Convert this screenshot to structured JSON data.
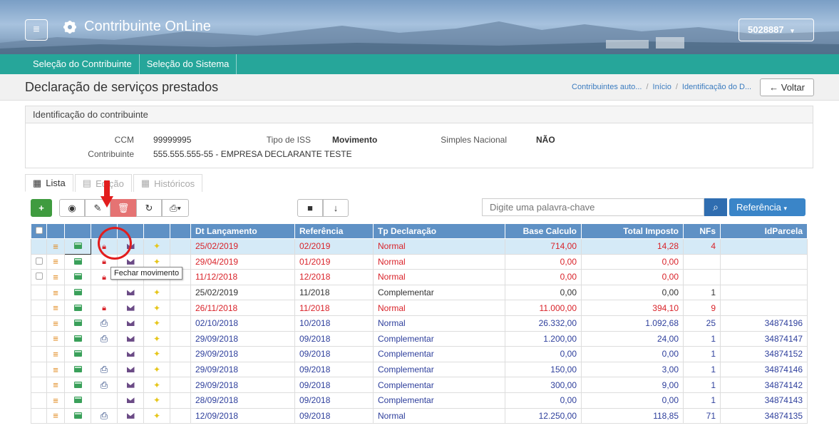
{
  "header": {
    "app_title": "Contribuinte OnLine",
    "user_id": "5028887"
  },
  "nav": {
    "items": [
      "Seleção do Contribuinte",
      "Seleção do Sistema"
    ]
  },
  "page": {
    "title": "Declaração de serviços prestados",
    "breadcrumbs": [
      "Contribuintes auto...",
      "Início",
      "Identificação do D..."
    ],
    "back_label": "Voltar"
  },
  "panel": {
    "title": "Identificação do contribuinte",
    "ccm_label": "CCM",
    "ccm_value": "99999995",
    "contribuinte_label": "Contribuinte",
    "contribuinte_value": "555.555.555-55 - EMPRESA DECLARANTE TESTE",
    "tipo_iss_label": "Tipo de ISS",
    "tipo_iss_value": "Movimento",
    "simples_label": "Simples Nacional",
    "simples_value": "NÃO"
  },
  "tabs": [
    {
      "label": "Lista"
    },
    {
      "label": "Edição"
    },
    {
      "label": "Históricos"
    }
  ],
  "search": {
    "placeholder": "Digite uma palavra-chave",
    "filter_label": "Referência"
  },
  "table": {
    "headers": [
      "Dt Lançamento",
      "Referência",
      "Tp Declaração",
      "Base Calculo",
      "Total Imposto",
      "NFs",
      "IdParcela"
    ],
    "rows": [
      {
        "dt": "25/02/2019",
        "ref": "02/2019",
        "tp": "Normal",
        "base": "714,00",
        "total": "14,28",
        "nfs": "4",
        "id": "",
        "color": "red",
        "lock": true,
        "print": false,
        "chk": false
      },
      {
        "dt": "29/04/2019",
        "ref": "01/2019",
        "tp": "Normal",
        "base": "0,00",
        "total": "0,00",
        "nfs": "",
        "id": "",
        "color": "red",
        "lock": true,
        "print": false,
        "chk": true
      },
      {
        "dt": "11/12/2018",
        "ref": "12/2018",
        "tp": "Normal",
        "base": "0,00",
        "total": "0,00",
        "nfs": "",
        "id": "",
        "color": "red",
        "lock": true,
        "print": false,
        "chk": true
      },
      {
        "dt": "25/02/2019",
        "ref": "11/2018",
        "tp": "Complementar",
        "base": "0,00",
        "total": "0,00",
        "nfs": "1",
        "id": "",
        "color": "dark",
        "lock": false,
        "print": false,
        "chk": false
      },
      {
        "dt": "26/11/2018",
        "ref": "11/2018",
        "tp": "Normal",
        "base": "11.000,00",
        "total": "394,10",
        "nfs": "9",
        "id": "",
        "color": "red",
        "lock": true,
        "print": false,
        "chk": false
      },
      {
        "dt": "02/10/2018",
        "ref": "10/2018",
        "tp": "Normal",
        "base": "26.332,00",
        "total": "1.092,68",
        "nfs": "25",
        "id": "34874196",
        "color": "blue",
        "lock": false,
        "print": true,
        "chk": false
      },
      {
        "dt": "29/09/2018",
        "ref": "09/2018",
        "tp": "Complementar",
        "base": "1.200,00",
        "total": "24,00",
        "nfs": "1",
        "id": "34874147",
        "color": "blue",
        "lock": false,
        "print": true,
        "chk": false
      },
      {
        "dt": "29/09/2018",
        "ref": "09/2018",
        "tp": "Complementar",
        "base": "0,00",
        "total": "0,00",
        "nfs": "1",
        "id": "34874152",
        "color": "blue",
        "lock": false,
        "print": false,
        "chk": false
      },
      {
        "dt": "29/09/2018",
        "ref": "09/2018",
        "tp": "Complementar",
        "base": "150,00",
        "total": "3,00",
        "nfs": "1",
        "id": "34874146",
        "color": "blue",
        "lock": false,
        "print": true,
        "chk": false
      },
      {
        "dt": "29/09/2018",
        "ref": "09/2018",
        "tp": "Complementar",
        "base": "300,00",
        "total": "9,00",
        "nfs": "1",
        "id": "34874142",
        "color": "blue",
        "lock": false,
        "print": true,
        "chk": false
      },
      {
        "dt": "28/09/2018",
        "ref": "09/2018",
        "tp": "Complementar",
        "base": "0,00",
        "total": "0,00",
        "nfs": "1",
        "id": "34874143",
        "color": "blue",
        "lock": false,
        "print": false,
        "chk": false
      },
      {
        "dt": "12/09/2018",
        "ref": "09/2018",
        "tp": "Normal",
        "base": "12.250,00",
        "total": "118,85",
        "nfs": "71",
        "id": "34874135",
        "color": "blue",
        "lock": false,
        "print": true,
        "chk": false
      }
    ]
  },
  "tooltip": {
    "text": "Fechar movimento"
  },
  "colors": {
    "nav": "#26a69a",
    "table_header": "#5f91c5",
    "accent_red": "#d9232a",
    "add_button": "#3f9b3f"
  }
}
